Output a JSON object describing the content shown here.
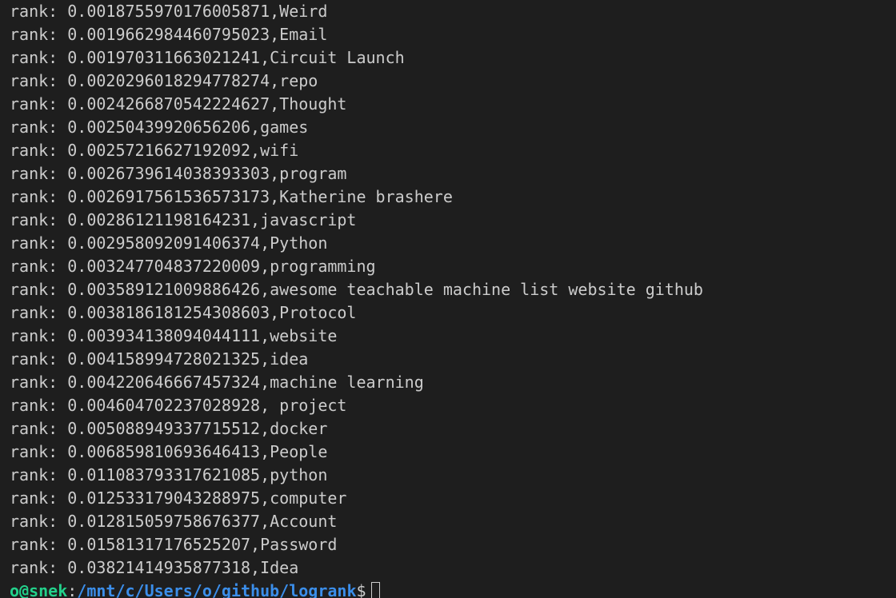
{
  "terminal": {
    "lines": [
      "rank: 0.0018755970176005871,Weird",
      "rank: 0.0019662984460795023,Email",
      "rank: 0.001970311663021241,Circuit Launch",
      "rank: 0.0020296018294778274,repo",
      "rank: 0.0024266870542224627,Thought",
      "rank: 0.00250439920656206,games",
      "rank: 0.00257216627192092,wifi",
      "rank: 0.0026739614038393303,program",
      "rank: 0.0026917561536573173,Katherine brashere",
      "rank: 0.00286121198164231,javascript",
      "rank: 0.002958092091406374,Python",
      "rank: 0.003247704837220009,programming",
      "rank: 0.003589121009886426,awesome teachable machine list website github",
      "rank: 0.0038186181254308603,Protocol",
      "rank: 0.003934138094044111,website",
      "rank: 0.004158994728021325,idea",
      "rank: 0.004220646667457324,machine learning",
      "rank: 0.004604702237028928, project",
      "rank: 0.005088949337715512,docker",
      "rank: 0.006859810693646413,People",
      "rank: 0.011083793317621085,python",
      "rank: 0.012533179043288975,computer",
      "rank: 0.012815059758676377,Account",
      "rank: 0.01581317176525207,Password",
      "rank: 0.03821414935877318,Idea"
    ],
    "prompt": {
      "user_host": "o@snek",
      "separator": ":",
      "path": "/mnt/c/Users/o/github/logrank",
      "symbol": "$"
    },
    "colors": {
      "background": "#1e1e1e",
      "text": "#cccccc",
      "user_host": "#23d18b",
      "path": "#3b8eea"
    }
  }
}
